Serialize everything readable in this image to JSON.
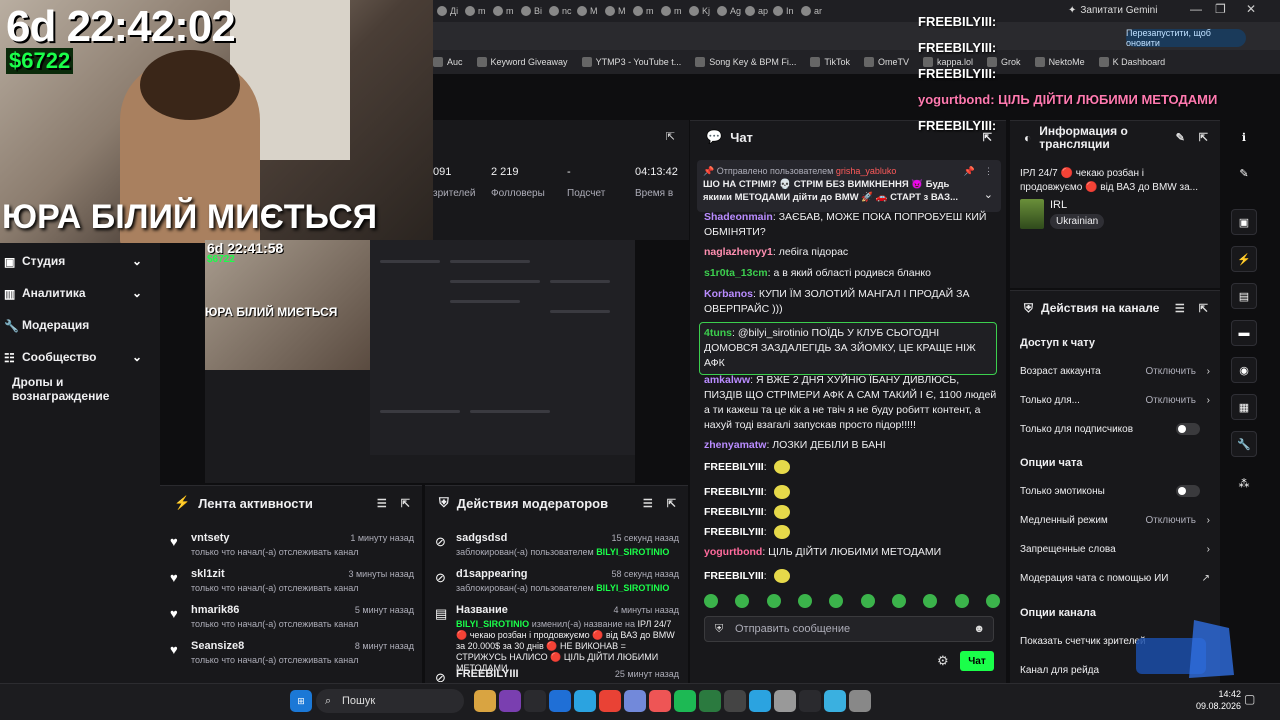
{
  "browser": {
    "tabs": [
      "Дi",
      "m",
      "m",
      "Bi",
      "nc",
      "M",
      "M",
      "m",
      "m",
      "Kj",
      "Ag",
      "ap",
      "In",
      "ar"
    ],
    "gemini": "Запитати Gemini",
    "restart_button": "Перезапустити, щоб оновити",
    "bookmarks": [
      "Auc",
      "Keyword Giveaway",
      "YTMP3 - YouTube t...",
      "Song Key & BPM Fi...",
      "TikTok",
      "OmeTV",
      "kappa.lol",
      "Grok",
      "NektoMe",
      "K Dashboard"
    ]
  },
  "webcam": {
    "timer": "6d 22:42:02",
    "money": "$6722",
    "title": "ЮРА БІЛИЙ МИЄТЬСЯ"
  },
  "sidebar": {
    "items": [
      {
        "label": "Студия",
        "icon": "studio-icon",
        "chevron": true
      },
      {
        "label": "Аналитика",
        "icon": "analytics-icon",
        "chevron": true
      },
      {
        "label": "Модерация",
        "icon": "wrench-icon",
        "chevron": false
      },
      {
        "label": "Сообщество",
        "icon": "community-icon",
        "chevron": true
      },
      {
        "label": "Дропы и вознаграждение",
        "icon": "",
        "chevron": false
      }
    ]
  },
  "stats": {
    "values": [
      "091",
      "2 219",
      "-",
      "04:13:42"
    ],
    "labels": [
      "зрителей",
      "Фолловеры",
      "Подсчет",
      "Время в"
    ]
  },
  "preview": {
    "timer": "6d 22:41:58",
    "money": "$6722",
    "title": "ЮРА БІЛИЙ МИЄТЬСЯ"
  },
  "activity": {
    "title": "Лента активности",
    "items": [
      {
        "name": "vntsety",
        "desc": "только что начал(-а) отслеживать канал",
        "time": "1 минуту назад"
      },
      {
        "name": "skl1zit",
        "desc": "только что начал(-а) отслеживать канал",
        "time": "3 минуты назад"
      },
      {
        "name": "hmarik86",
        "desc": "только что начал(-а) отслеживать канал",
        "time": "5 минут назад"
      },
      {
        "name": "Seansize8",
        "desc": "только что начал(-а) отслеживать канал",
        "time": "8 минут назад"
      }
    ]
  },
  "mod_actions": {
    "title": "Действия модераторов",
    "items": [
      {
        "name": "sadgsdsd",
        "desc_prefix": "заблокирован(-а) пользователем ",
        "desc_tag": "BILYI_SIROTINIO",
        "time": "15 секунд назад"
      },
      {
        "name": "d1sappearing",
        "desc_prefix": "заблокирован(-а) пользователем ",
        "desc_tag": "BILYI_SIROTINIO",
        "time": "58 секунд назад"
      },
      {
        "name": "Название",
        "desc_tag": "BILYI_SIROTINIO",
        "desc_prefix": " изменил(-а) название на ",
        "desc_rest": "ІРЛ 24/7 🔴 чекаю розбан і продовжуємо 🔴 від ВАЗ до BMW за 20.000$ за 30 днів 🔴 НЕ ВИКОНАВ = СТРИЖУСЬ НАЛИСО 🔴 ЦІЛЬ ДІЙТИ ЛЮБИМИ МЕТОДАМИ",
        "time": "4 минуты назад"
      },
      {
        "name": "FREEBILYIII",
        "time": "25 минут назад"
      }
    ]
  },
  "chat": {
    "title": "Чат",
    "pinned_by_prefix": "Отправлено пользователем",
    "pinned_by": "grisha_yabluko",
    "pinned_text": "ШО НА СТРІМІ? 💀 СТРІМ БЕЗ ВИМКНЕННЯ 😈 Будь якими МЕТОДАМИ дійти до BMW 🚀 🚗 СТАРТ з ВАЗ...",
    "messages": [
      {
        "user": "Shadeonmain",
        "color": "#b98cff",
        "text": "ЗАЄБАВ, МОЖЕ ПОКА ПОПРОБУЕШ КИЙ ОБМІНЯТИ?"
      },
      {
        "user": "naglazhenyy1",
        "color": "#ff8fb1",
        "text": "лебіга підорас"
      },
      {
        "user": "s1r0ta_13cm",
        "color": "#3ccf4e",
        "text": "а в який області родився бланко"
      },
      {
        "user": "Korbanos",
        "color": "#b98cff",
        "text": "КУПИ ЇМ ЗОЛОТИЙ МАНГАЛ І ПРОДАЙ ЗА ОВЕРПРАЙС )))"
      },
      {
        "user": "4tuns",
        "color": "#3ccf4e",
        "text": "@bilyi_sirotinio ПОЇДЬ У КЛУБ СЬОГОДНІ ДОМОВСЯ ЗАЗДАЛЕГІДЬ ЗА ЗЙОМКУ, ЦЕ КРАЩЕ НІЖ АФК"
      },
      {
        "user": "amkalww",
        "color": "#b98cff",
        "text": "Я ВЖЕ 2 ДНЯ ХУЙНЮ ЇБАНУ ДИВЛЮСЬ, ПИЗДІВ ЩО СТРІМЕРИ АФК А САМ ТАКИЙ І Є, 1100 людей а ти кажеш та це кік а не твіч я не буду робитт контент, а нахуй тоді взагалі запускав просто підор!!!!!"
      },
      {
        "user": "zhenyamatw",
        "color": "#b98cff",
        "text": "ЛОЗКИ ДЕБІЛИ В БАНІ"
      },
      {
        "user": "FREEBILYIII",
        "color": "#ffffff",
        "text": ""
      },
      {
        "user": "FREEBILYIII",
        "color": "#ffffff",
        "text": ""
      },
      {
        "user": "FREEBILYIII",
        "color": "#ffffff",
        "text": ""
      },
      {
        "user": "FREEBILYIII",
        "color": "#ffffff",
        "text": ""
      },
      {
        "user": "yogurtbond",
        "color": "#ff6b9d",
        "text": "ЦІЛЬ ДІЙТИ ЛЮБИМИ МЕТОДАМИ"
      },
      {
        "user": "FREEBILYIII",
        "color": "#ffffff",
        "text": ""
      }
    ],
    "input_placeholder": "Отправить сообщение",
    "send_label": "Чат"
  },
  "overlay": {
    "lines": [
      "FREEBILYIII:",
      "FREEBILYIII:",
      "FREEBILYIII:",
      "yogurtbond: ЦІЛЬ ДІЙТИ ЛЮБИМИ МЕТОДАМИ",
      "FREEBILYIII:"
    ]
  },
  "info": {
    "title": "Информация о трансляции",
    "stream_title": "ІРЛ 24/7 🔴 чекаю розбан і продовжуємо 🔴 від ВАЗ до BMW за...",
    "category": "IRL",
    "language": "Ukrainian"
  },
  "actions": {
    "title": "Действия на канале",
    "chat_access": "Доступ к чату",
    "account_age": "Возраст аккаунта",
    "account_age_val": "Отключить",
    "only_for": "Только для...",
    "only_for_val": "Отключить",
    "subs_only": "Только для подписчиков",
    "chat_options": "Опции чата",
    "emotes_only": "Только эмотиконы",
    "slow_mode": "Медленный режим",
    "slow_mode_val": "Отключить",
    "banned_words": "Запрещенные слова",
    "ai_mod": "Модерация чата с помощью ИИ",
    "channel_options": "Опции канала",
    "show_viewers": "Показать счетчик зрителей",
    "raid_channel": "Канал для рейда"
  },
  "taskbar": {
    "search": "Пошук",
    "time": "14:42",
    "date": "09.08.2026"
  },
  "colors": {
    "accent": "#1aff4a",
    "bg": "#0e0e10",
    "panel": "#18181b"
  }
}
